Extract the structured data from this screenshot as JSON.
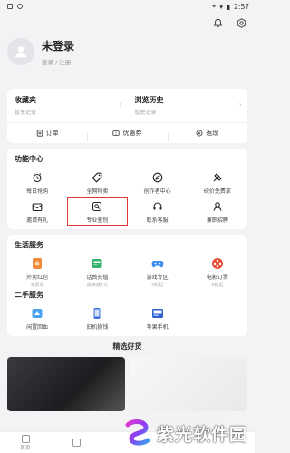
{
  "status_bar": {
    "time": "2:57"
  },
  "profile": {
    "name": "未登录",
    "sub": "登录 / 注册"
  },
  "records": {
    "favorites": {
      "title": "收藏夹",
      "sub": "暂无记录"
    },
    "history": {
      "title": "浏览历史",
      "sub": "暂无记录"
    },
    "links": [
      {
        "label": "订单",
        "icon": "order-icon"
      },
      {
        "label": "优惠券",
        "icon": "coupon-icon"
      },
      {
        "label": "返现",
        "icon": "cashback-icon"
      }
    ]
  },
  "functions": {
    "title": "功能中心",
    "items": [
      {
        "label": "每日抢购",
        "icon": "alarm-clock-icon"
      },
      {
        "label": "全网特卖",
        "icon": "sale-tag-icon"
      },
      {
        "label": "创作者中心",
        "icon": "creator-icon"
      },
      {
        "label": "砍价免费拿",
        "icon": "bargain-icon"
      },
      {
        "label": "邀请有礼",
        "icon": "invite-gift-icon"
      },
      {
        "label": "专业鉴别",
        "icon": "appraisal-icon"
      },
      {
        "label": "联系客服",
        "icon": "headset-icon"
      },
      {
        "label": "兼职招聘",
        "icon": "recruit-icon"
      }
    ]
  },
  "life": {
    "title": "生活服务",
    "items": [
      {
        "label": "外卖红包",
        "sub": "免费领",
        "icon": "takeout-icon",
        "color": "#f08a3a"
      },
      {
        "label": "话费充值",
        "sub": "最高减7元",
        "icon": "phone-bill-icon",
        "color": "#35b36b"
      },
      {
        "label": "游戏专区",
        "sub": "3折起",
        "icon": "gamepad-icon",
        "color": "#3d8cf0"
      },
      {
        "label": "电影订票",
        "sub": "8折起",
        "icon": "film-icon",
        "color": "#e8503a"
      }
    ]
  },
  "second_hand": {
    "title": "二手服务",
    "items": [
      {
        "label": "闲置回血",
        "icon": "recycle-icon"
      },
      {
        "label": "旧机换钱",
        "icon": "old-phone-icon"
      },
      {
        "label": "苹果手机",
        "icon": "iphone-icon"
      }
    ]
  },
  "picks": {
    "title": "精选好货"
  },
  "nav": [
    {
      "label": "首页",
      "icon": "home-icon"
    },
    {
      "label": "",
      "icon": "category-icon"
    }
  ],
  "watermark": {
    "text": "紫光软件园"
  },
  "colors": {
    "highlight": "#e23a3a",
    "background": "#f3f3f5"
  }
}
